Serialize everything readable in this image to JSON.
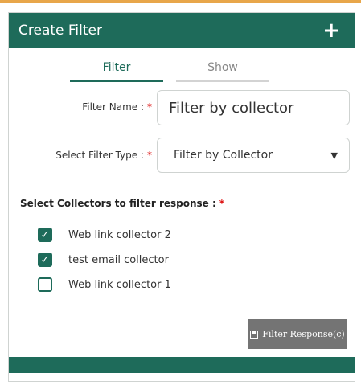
{
  "header": {
    "title": "Create Filter",
    "add_icon": "+"
  },
  "tabs": [
    {
      "label": "Filter",
      "active": true
    },
    {
      "label": "Show",
      "active": false
    }
  ],
  "form": {
    "filter_name_label": "Filter Name :",
    "filter_name_value": "Filter by collector",
    "filter_type_label": "Select Filter Type :",
    "filter_type_value": "Filter by Collector",
    "required_marker": "*"
  },
  "collectors_section": {
    "label": "Select Collectors to filter response :",
    "items": [
      {
        "label": "Web link collector 2",
        "checked": true
      },
      {
        "label": "test email collector",
        "checked": true
      },
      {
        "label": "Web link collector 1",
        "checked": false
      }
    ]
  },
  "actions": {
    "filter_button_label": "Filter Response(c)",
    "filter_button_icon": "save-icon"
  },
  "colors": {
    "primary": "#1e6b5a",
    "button_gray": "#747474",
    "required": "#dd1111"
  }
}
